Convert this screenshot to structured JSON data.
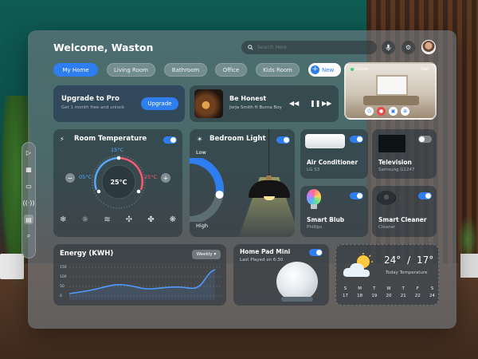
{
  "header": {
    "welcome": "Welcome, Waston",
    "search_placeholder": "Search Here",
    "mic_icon": "mic-icon",
    "settings_icon": "gear-icon"
  },
  "tabs": [
    {
      "label": "My Home",
      "active": true
    },
    {
      "label": "Living Room",
      "active": false
    },
    {
      "label": "Bathroom",
      "active": false
    },
    {
      "label": "Office",
      "active": false
    },
    {
      "label": "Kids Room",
      "active": false
    }
  ],
  "new_button": {
    "label": "New"
  },
  "camera": {
    "status": "Online",
    "room": "Hall"
  },
  "upgrade": {
    "title": "Upgrade to Pro",
    "subtitle": "Get 1 month free and unlock",
    "button": "Upgrade"
  },
  "music": {
    "song": "Be Honest",
    "artist": "Jorja Smith ft Burna Boy"
  },
  "room_temperature": {
    "title": "Room Temperature",
    "current": "25°C",
    "top": "15°C",
    "left": "05°C",
    "right": "25°C",
    "minus": "−",
    "plus": "+"
  },
  "bedroom_light": {
    "title": "Bedroom Light",
    "low": "Low",
    "high": "High",
    "level": 0.55
  },
  "devices": [
    {
      "name": "Air Conditioner",
      "model": "LG S3",
      "on": true
    },
    {
      "name": "Television",
      "model": "Samsung G1247",
      "on": false
    },
    {
      "name": "Smart Blub",
      "model": "Phillips",
      "on": true
    },
    {
      "name": "Smart Cleaner",
      "model": "Cleaner",
      "on": true
    }
  ],
  "energy": {
    "title": "Energy (KWH)",
    "period": "Weekly",
    "y_ticks": [
      "150",
      "100",
      "50",
      "0"
    ]
  },
  "home_pad": {
    "title": "Home Pad Mini",
    "subtitle": "Last Played on 6:30",
    "on": true
  },
  "weather": {
    "high": "24°",
    "separator": "/",
    "low": "17°",
    "label": "Today Temperature",
    "days": [
      {
        "day": "S",
        "date": "17"
      },
      {
        "day": "M",
        "date": "18"
      },
      {
        "day": "T",
        "date": "19"
      },
      {
        "day": "W",
        "date": "20"
      },
      {
        "day": "T",
        "date": "21"
      },
      {
        "day": "F",
        "date": "22"
      },
      {
        "day": "S",
        "date": "24"
      }
    ]
  },
  "colors": {
    "accent": "#2f7ef0",
    "cold": "#5aa9ff",
    "hot": "#ff5a6e"
  }
}
